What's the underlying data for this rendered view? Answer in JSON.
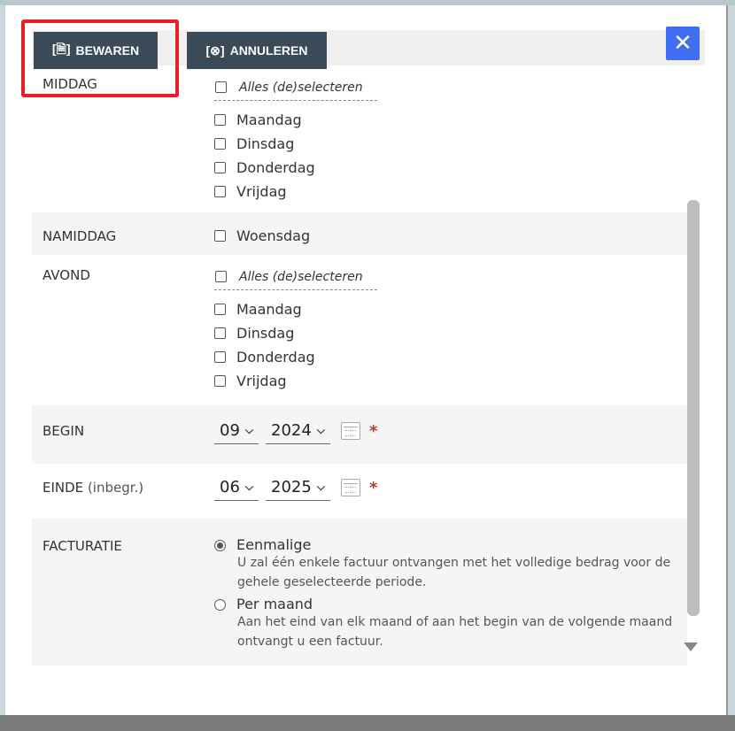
{
  "toolbar": {
    "save_label": "BEWAREN",
    "save_icon": "save-icon",
    "cancel_label": "ANNULEREN",
    "cancel_icon": "cancel-icon",
    "close_symbol": "✕"
  },
  "sections": {
    "middag": {
      "label": "MIDDAG",
      "select_all": "Alles (de)selecteren",
      "days": [
        "Maandag",
        "Dinsdag",
        "Donderdag",
        "Vrijdag"
      ]
    },
    "namiddag": {
      "label": "NAMIDDAG",
      "days": [
        "Woensdag"
      ]
    },
    "avond": {
      "label": "AVOND",
      "select_all": "Alles (de)selecteren",
      "days": [
        "Maandag",
        "Dinsdag",
        "Donderdag",
        "Vrijdag"
      ]
    },
    "begin": {
      "label": "BEGIN",
      "month": "09",
      "year": "2024",
      "required": "*"
    },
    "einde": {
      "label": "EINDE",
      "label_sub": "(inbegr.)",
      "month": "06",
      "year": "2025",
      "required": "*"
    },
    "facturatie": {
      "label": "FACTURATIE",
      "options": [
        {
          "label": "Eenmalige",
          "description": "U zal één enkele factuur ontvangen met het volledige bedrag voor de gehele geselecteerde periode.",
          "selected": true
        },
        {
          "label": "Per maand",
          "description": "Aan het eind van elk maand of aan het begin van de volgende maand ontvangt u een factuur.",
          "selected": false
        }
      ]
    }
  },
  "colors": {
    "button_bg": "#3b4a59",
    "highlight": "#e8202a",
    "close_bg": "#3f6ff0",
    "required": "#c0392b"
  }
}
